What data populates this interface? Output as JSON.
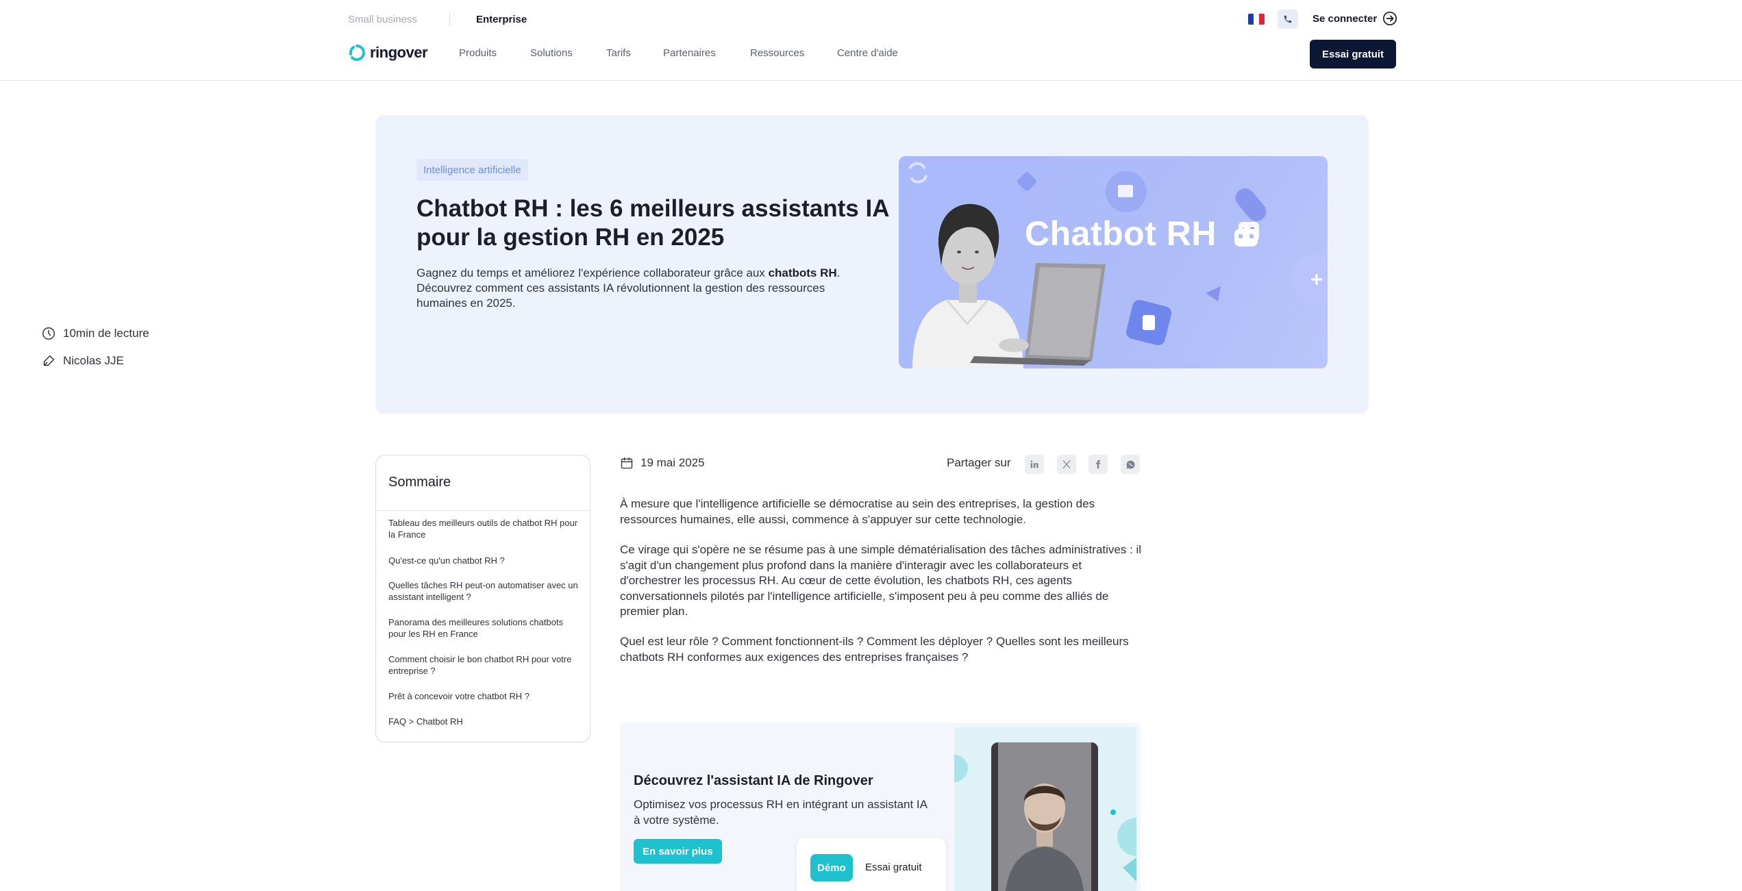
{
  "header": {
    "segments": {
      "small_business": "Small business",
      "enterprise": "Enterprise"
    },
    "login_label": "Se connecter",
    "logo_text": "ringover",
    "nav": [
      "Produits",
      "Solutions",
      "Tarifs",
      "Partenaires",
      "Ressources",
      "Centre d'aide"
    ],
    "cta_label": "Essai gratuit",
    "colors": {
      "primary_dark": "#0c1734",
      "accent_cyan": "#1ec1ce"
    }
  },
  "hero": {
    "tag": "Intelligence artificielle",
    "title": "Chatbot RH : les 6 meilleurs assistants IA pour la gestion RH en 2025",
    "desc_before": "Gagnez du temps et améliorez l'expérience collaborateur grâce aux ",
    "desc_bold": "chatbots RH",
    "desc_after": ". Découvrez comment ces assistants IA révolutionnent la gestion des ressources humaines en 2025.",
    "reading_time": "10min de lecture",
    "author": "Nicolas JJE",
    "image_title": "Chatbot RH",
    "image_bg": "#aebcf8"
  },
  "toc": {
    "title": "Sommaire",
    "items": [
      "Tableau des meilleurs outils de chatbot RH pour la France",
      "Qu'est-ce qu'un chatbot RH ?",
      "Quelles tâches RH peut-on automatiser avec un assistant intelligent ?",
      "Panorama des meilleures solutions chatbots pour les RH en France",
      "Comment choisir le bon chatbot RH pour votre entreprise ?",
      "Prêt à concevoir votre chatbot RH ?",
      "FAQ > Chatbot RH"
    ]
  },
  "article": {
    "date": "19 mai 2025",
    "share_label": "Partager sur",
    "share_icons": [
      "linkedin-icon",
      "x-icon",
      "facebook-icon",
      "whatsapp-icon"
    ],
    "paragraphs": [
      "À mesure que l'intelligence artificielle se démocratise au sein des entreprises, la gestion des ressources humaines, elle aussi, commence à s'appuyer sur cette technologie.",
      "Ce virage qui s'opère ne se résume pas à une simple dématérialisation des tâches administratives : il s'agit d'un changement plus profond dans la manière d'interagir avec les collaborateurs et d'orchestrer les processus RH. Au cœur de cette évolution, les chatbots RH, ces agents conversationnels pilotés par l'intelligence artificielle, s'imposent peu à peu comme des alliés de premier plan.",
      "Quel est leur rôle ? Comment fonctionnent-ils ? Comment les déployer ? Quelles sont les meilleurs chatbots RH conformes aux exigences des entreprises françaises ?"
    ]
  },
  "promo": {
    "title": "Découvrez l'assistant IA de Ringover",
    "text": "Optimisez vos processus RH en intégrant un assistant IA à votre système.",
    "learn_more": "En savoir plus",
    "demo": "Démo",
    "trial": "Essai gratuit"
  }
}
